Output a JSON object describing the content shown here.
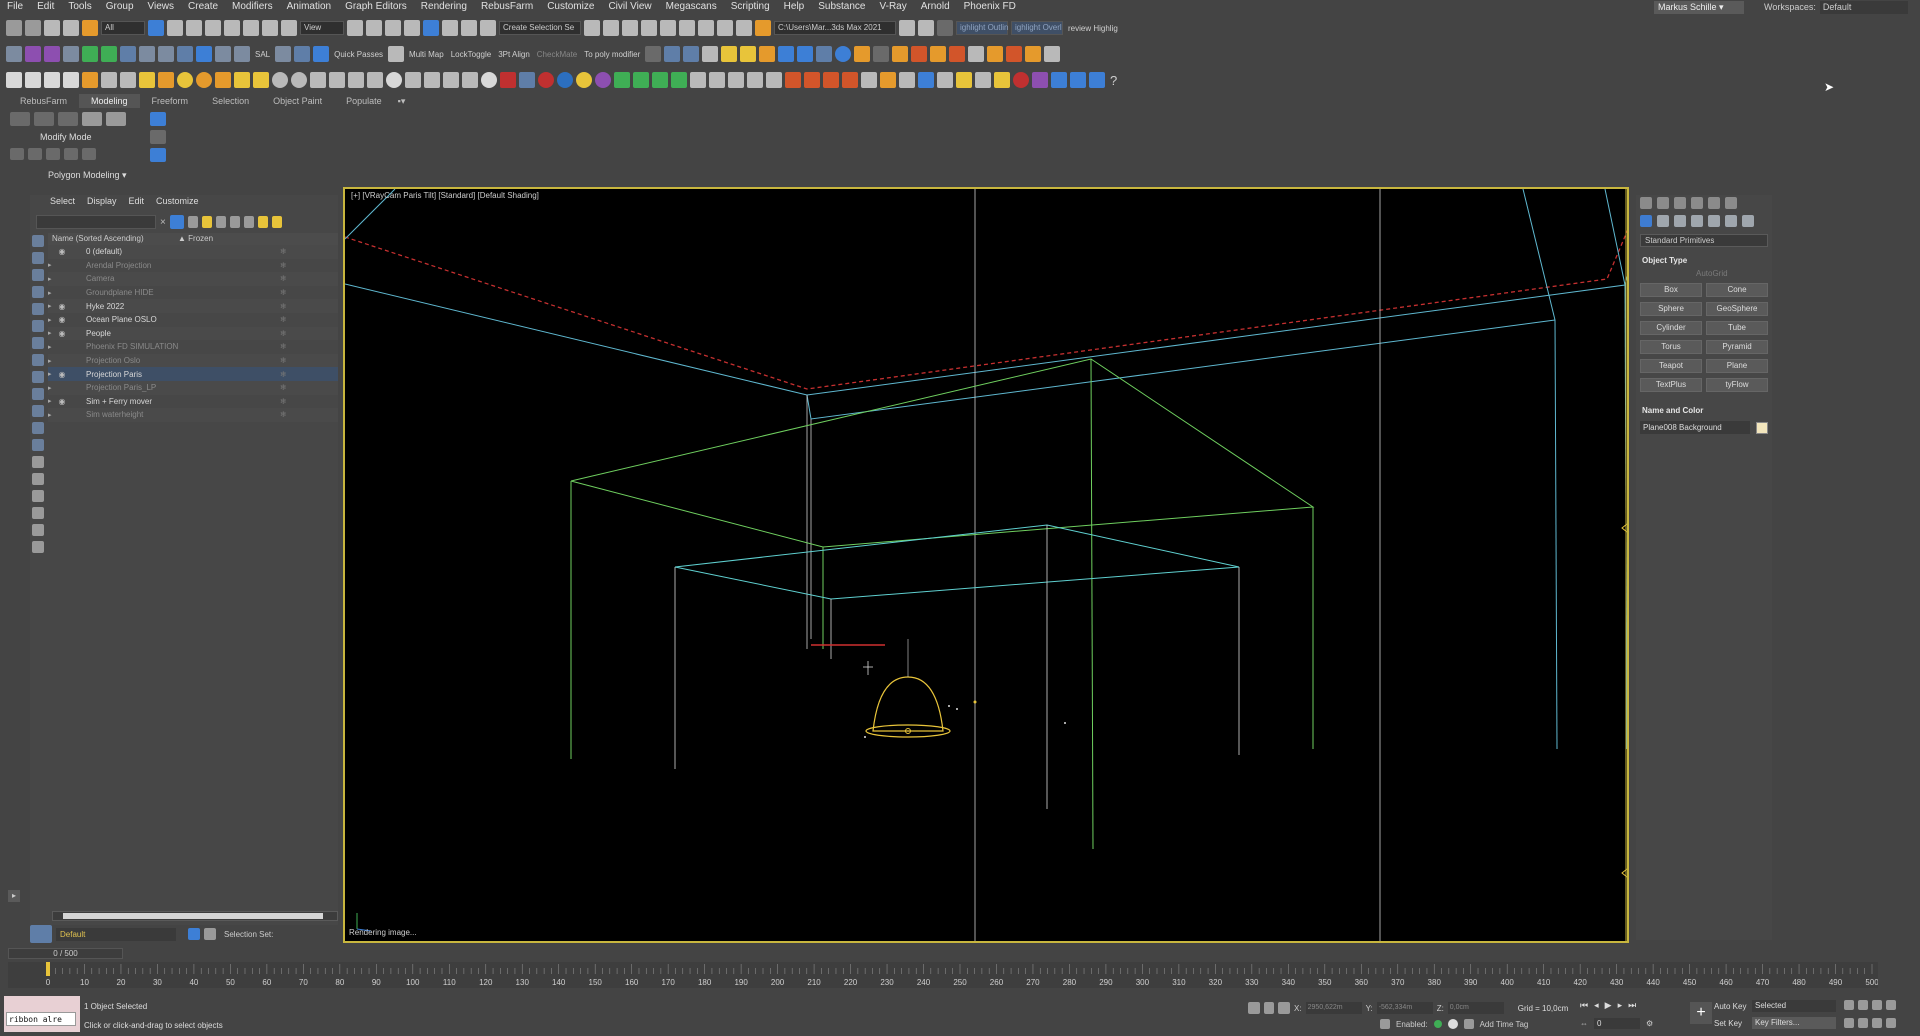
{
  "menu": [
    "File",
    "Edit",
    "Tools",
    "Group",
    "Views",
    "Create",
    "Modifiers",
    "Animation",
    "Graph Editors",
    "Rendering",
    "RebusFarm",
    "Customize",
    "Civil View",
    "Megascans",
    "Scripting",
    "Help",
    "Substance",
    "V-Ray",
    "Arnold",
    "Phoenix FD"
  ],
  "user_menu": "Markus Schille ▾",
  "workspace": {
    "label": "Workspaces:",
    "value": "Default"
  },
  "toolbar1": {
    "filter_value": "All",
    "view_value": "View",
    "create_selection": "Create Selection Se",
    "path_value": "C:\\Users\\Mar...3ds Max 2021",
    "highlight1": "ighlight Outlin",
    "highlight2": "ighlight Overl",
    "highlight3": "review Highlig"
  },
  "toolbar2": {
    "sal": "SAL",
    "quick_passes": "Quick Passes",
    "multi_map": "Multi Map",
    "lock_toggle": "LockToggle",
    "align": "3Pt Align",
    "checkmate": "CheckMate",
    "poly_modifier": "To poly modifier"
  },
  "ribbon": {
    "tabs": [
      "RebusFarm",
      "Modeling",
      "Freeform",
      "Selection",
      "Object Paint",
      "Populate"
    ],
    "modify_mode": "Modify Mode",
    "polygon_modeling": "Polygon Modeling ▾"
  },
  "explorer": {
    "menu": [
      "Select",
      "Display",
      "Edit",
      "Customize"
    ],
    "header_name": "Name (Sorted Ascending)",
    "header_frozen": "▲ Frozen",
    "rows": [
      {
        "name": "0 (default)",
        "hidden": false,
        "selected": false
      },
      {
        "name": "Arendal Projection",
        "hidden": true,
        "selected": false
      },
      {
        "name": "Camera",
        "hidden": true,
        "selected": false
      },
      {
        "name": "Groundplane HIDE",
        "hidden": true,
        "selected": false
      },
      {
        "name": "Hyke 2022",
        "hidden": false,
        "selected": false
      },
      {
        "name": "Ocean Plane OSLO",
        "hidden": false,
        "selected": false
      },
      {
        "name": "People",
        "hidden": false,
        "selected": false
      },
      {
        "name": "Phoenix FD SIMULATION",
        "hidden": true,
        "selected": false
      },
      {
        "name": "Projection Oslo",
        "hidden": true,
        "selected": false
      },
      {
        "name": "Projection Paris",
        "hidden": false,
        "selected": true
      },
      {
        "name": "Projection Paris_LP",
        "hidden": true,
        "selected": false
      },
      {
        "name": "Sim + Ferry mover",
        "hidden": false,
        "selected": false
      },
      {
        "name": "Sim waterheight",
        "hidden": true,
        "selected": false
      }
    ]
  },
  "layer_field": "Default",
  "selection_set_label": "Selection Set:",
  "viewport": {
    "label": "[+] [VRayCam Paris Tilt] [Standard] [Default Shading]",
    "status": "Rendering image..."
  },
  "command_panel": {
    "dropdown": "Standard Primitives",
    "object_type_title": "Object Type",
    "autogrid": "AutoGrid",
    "primitives": [
      "Box",
      "Cone",
      "Sphere",
      "GeoSphere",
      "Cylinder",
      "Tube",
      "Torus",
      "Pyramid",
      "Teapot",
      "Plane",
      "TextPlus",
      "tyFlow"
    ],
    "name_color_title": "Name and Color",
    "object_name": "Plane008 Background",
    "color": "#f3e6bd"
  },
  "timeline": {
    "slider": "0 / 500",
    "ticks": [
      0,
      10,
      20,
      30,
      40,
      50,
      60,
      70,
      80,
      90,
      100,
      110,
      120,
      130,
      140,
      150,
      160,
      170,
      180,
      190,
      200,
      210,
      220,
      230,
      240,
      250,
      260,
      270,
      280,
      290,
      300,
      310,
      320,
      330,
      340,
      350,
      360,
      370,
      380,
      390,
      400,
      410,
      420,
      430,
      440,
      450,
      460,
      470,
      480,
      490,
      500
    ]
  },
  "status": {
    "maxscript": "ribbon alre",
    "line1": "1 Object Selected",
    "line2": "Click or click-and-drag to select objects",
    "x_label": "X:",
    "x_value": "2950,622m",
    "y_label": "Y:",
    "y_value": "-562,334m",
    "z_label": "Z:",
    "z_value": "0,0cm",
    "grid": "Grid = 10,0cm",
    "enabled": "Enabled:",
    "add_time_tag": "Add Time Tag",
    "auto_key": "Auto Key",
    "set_key": "Set Key",
    "selected": "Selected",
    "key_filters": "Key Filters...",
    "frame": "0"
  }
}
